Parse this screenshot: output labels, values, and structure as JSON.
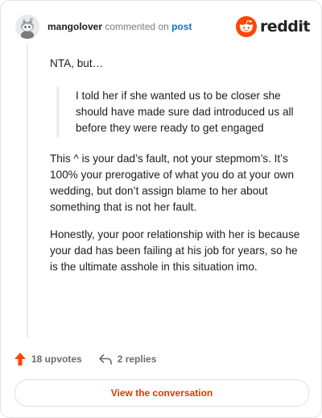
{
  "header": {
    "username": "mangolover",
    "action_text": "commented on",
    "post_link": "post",
    "brand": "reddit",
    "avatar_icon": "snoo-avatar-icon",
    "logo_icon": "reddit-snoo-logo-icon",
    "brand_color": "#ff4500"
  },
  "comment": {
    "p1": "NTA, but…",
    "quote": "I told her if she wanted us to be closer she should have made sure dad introduced us all before they were ready to get engaged",
    "p2": "This ^ is your dad’s fault, not your stepmom’s. It’s 100% your prerogative of what you do at your own wedding, but don’t assign blame to her about something that is not her fault.",
    "p3": "Honestly, your poor relationship with her is because your dad has been failing at his job for years, so he is the ultimate asshole in this situation imo."
  },
  "actions": {
    "upvotes": "18 upvotes",
    "replies": "2 replies",
    "upvote_icon": "upvote-arrow-icon",
    "reply_icon": "reply-arrow-icon",
    "upvote_color": "#ff4500"
  },
  "cta": {
    "label": "View the conversation",
    "color": "#d93a00"
  }
}
